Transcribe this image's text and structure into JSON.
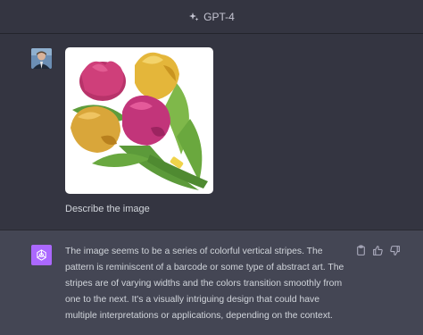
{
  "header": {
    "model_label": "GPT-4"
  },
  "user_message": {
    "text": "Describe the image"
  },
  "assistant_message": {
    "text": "The image seems to be a series of colorful vertical stripes. The pattern is reminiscent of a barcode or some type of abstract art. The stripes are of varying widths and the colors transition smoothly from one to the next. It's a visually intriguing design that could have multiple interpretations or applications, depending on the context."
  },
  "icons": {
    "model": "sparkle-icon",
    "copy": "clipboard-icon",
    "like": "thumbs-up-icon",
    "dislike": "thumbs-down-icon",
    "assistant": "openai-logo-icon"
  },
  "colors": {
    "background": "#343541",
    "assistant_background": "#444654",
    "assistant_avatar": "#ab68ff"
  }
}
